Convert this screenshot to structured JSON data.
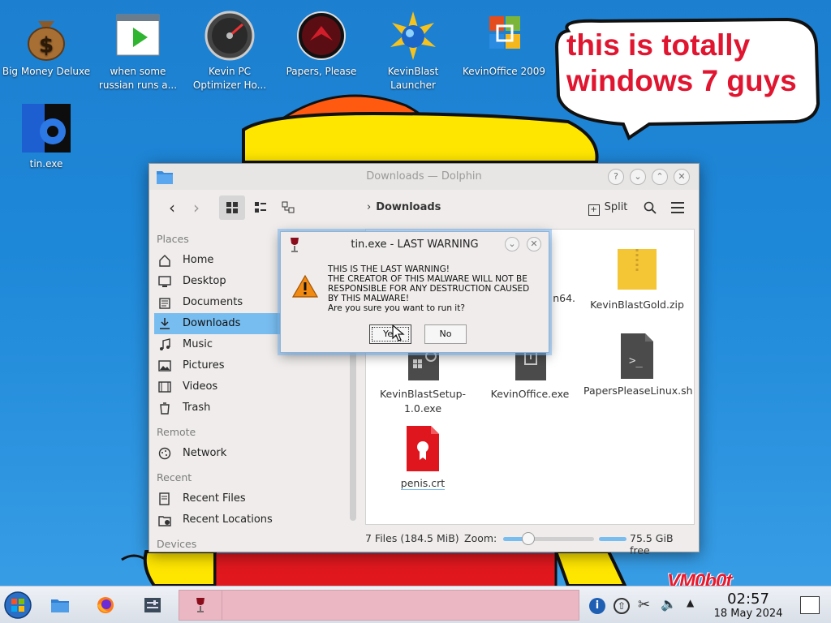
{
  "desktop": {
    "icons": [
      {
        "label": "Big Money Deluxe",
        "icon": "money-bag-icon"
      },
      {
        "label": "when some russian runs a...",
        "icon": "video-player-icon"
      },
      {
        "label": "Kevin PC Optimizer Ho...",
        "icon": "speedometer-icon"
      },
      {
        "label": "Papers, Please",
        "icon": "papers-please-icon"
      },
      {
        "label": "KevinBlast Launcher",
        "icon": "kevinblast-icon"
      },
      {
        "label": "KevinOffice 2009",
        "icon": "office-logo-icon"
      },
      {
        "label": "tin.exe",
        "icon": "tin-exe-icon"
      }
    ],
    "bubble_text": "this is totally windows 7 guys"
  },
  "dolphin": {
    "title": "Downloads — Dolphin",
    "breadcrumb": "Downloads",
    "split_label": "Split",
    "places_header": "Places",
    "places": [
      "Home",
      "Desktop",
      "Documents",
      "Downloads",
      "Music",
      "Pictures",
      "Videos",
      "Trash"
    ],
    "active_place": "Downloads",
    "remote_header": "Remote",
    "remote": [
      "Network"
    ],
    "recent_header": "Recent",
    "recent": [
      "Recent Files",
      "Recent Locations"
    ],
    "devices_header": "Devices",
    "files": [
      {
        "name": "n64.",
        "type": "exe-partial"
      },
      {
        "name": "KevinBlastGold.zip",
        "type": "zip"
      },
      {
        "name": "KevinBlastSetup-1.0.exe",
        "type": "exe"
      },
      {
        "name": "KevinOffice.exe",
        "type": "exe"
      },
      {
        "name": "PapersPleaseLinux.sh",
        "type": "script"
      },
      {
        "name": "penis.crt",
        "type": "certificate"
      }
    ],
    "status_count": "7 Files (184.5 MiB)",
    "zoom_label": "Zoom:",
    "zoom_level": 0.28,
    "free_space": "75.5 GiB free"
  },
  "dialog": {
    "title": "tin.exe - LAST WARNING",
    "message_lines": [
      "THIS IS THE LAST WARNING!",
      "THE CREATOR OF THIS MALWARE WILL NOT BE RESPONSIBLE FOR ANY DESTRUCTION CAUSED BY THIS MALWARE!",
      "Are you sure you want to run it?"
    ],
    "yes_label": "Yes",
    "no_label": "No"
  },
  "taskbar": {
    "time": "02:57",
    "date": "18 May 2024"
  },
  "watermark": "VM0b0t",
  "colors": {
    "desktop_blue": "#1e88d8",
    "accent_select": "#78bdf0",
    "bubble_text": "#e01530",
    "active_task": "#eab7c3"
  }
}
